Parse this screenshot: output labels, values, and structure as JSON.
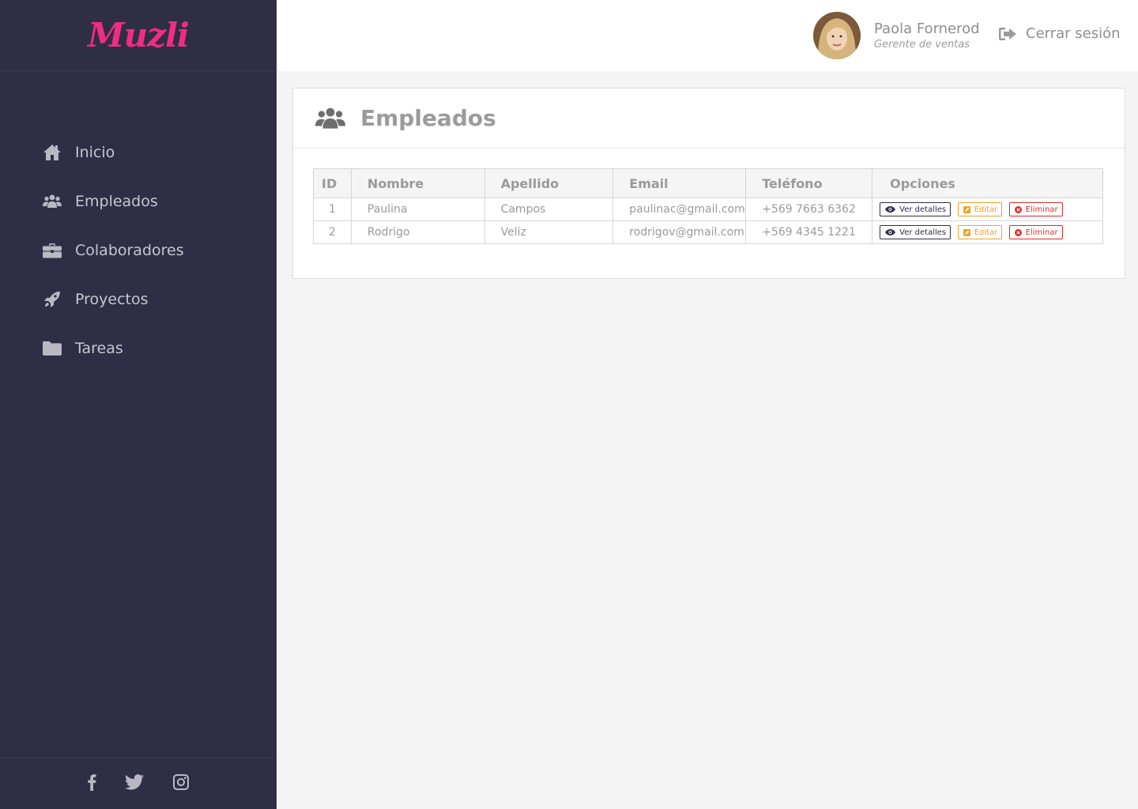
{
  "brand": {
    "logo_text": "Muzli",
    "accent_color": "#ef2d83"
  },
  "sidebar": {
    "items": [
      {
        "label": "Inicio",
        "icon": "home-icon"
      },
      {
        "label": "Empleados",
        "icon": "users-icon"
      },
      {
        "label": "Colaboradores",
        "icon": "briefcase-icon"
      },
      {
        "label": "Proyectos",
        "icon": "rocket-icon"
      },
      {
        "label": "Tareas",
        "icon": "folder-icon"
      }
    ],
    "social": [
      "facebook-icon",
      "twitter-icon",
      "instagram-icon"
    ]
  },
  "header": {
    "user_name": "Paola Fornerod",
    "user_role": "Gerente de ventas",
    "logout_label": "Cerrar sesión"
  },
  "page": {
    "title": "Empleados",
    "icon": "users-icon"
  },
  "table": {
    "columns": [
      "ID",
      "Nombre",
      "Apellido",
      "Email",
      "Teléfono",
      "Opciones"
    ],
    "rows": [
      {
        "id": "1",
        "nombre": "Paulina",
        "apellido": "Campos",
        "email": "paulinac@gmail.com",
        "telefono": "+569 7663 6362"
      },
      {
        "id": "2",
        "nombre": "Rodrigo",
        "apellido": "Veliz",
        "email": "rodrigov@gmail.com",
        "telefono": "+569 4345 1221"
      }
    ],
    "actions": {
      "view_label": "Ver detalles",
      "edit_label": "Editar",
      "delete_label": "Eliminar"
    }
  }
}
